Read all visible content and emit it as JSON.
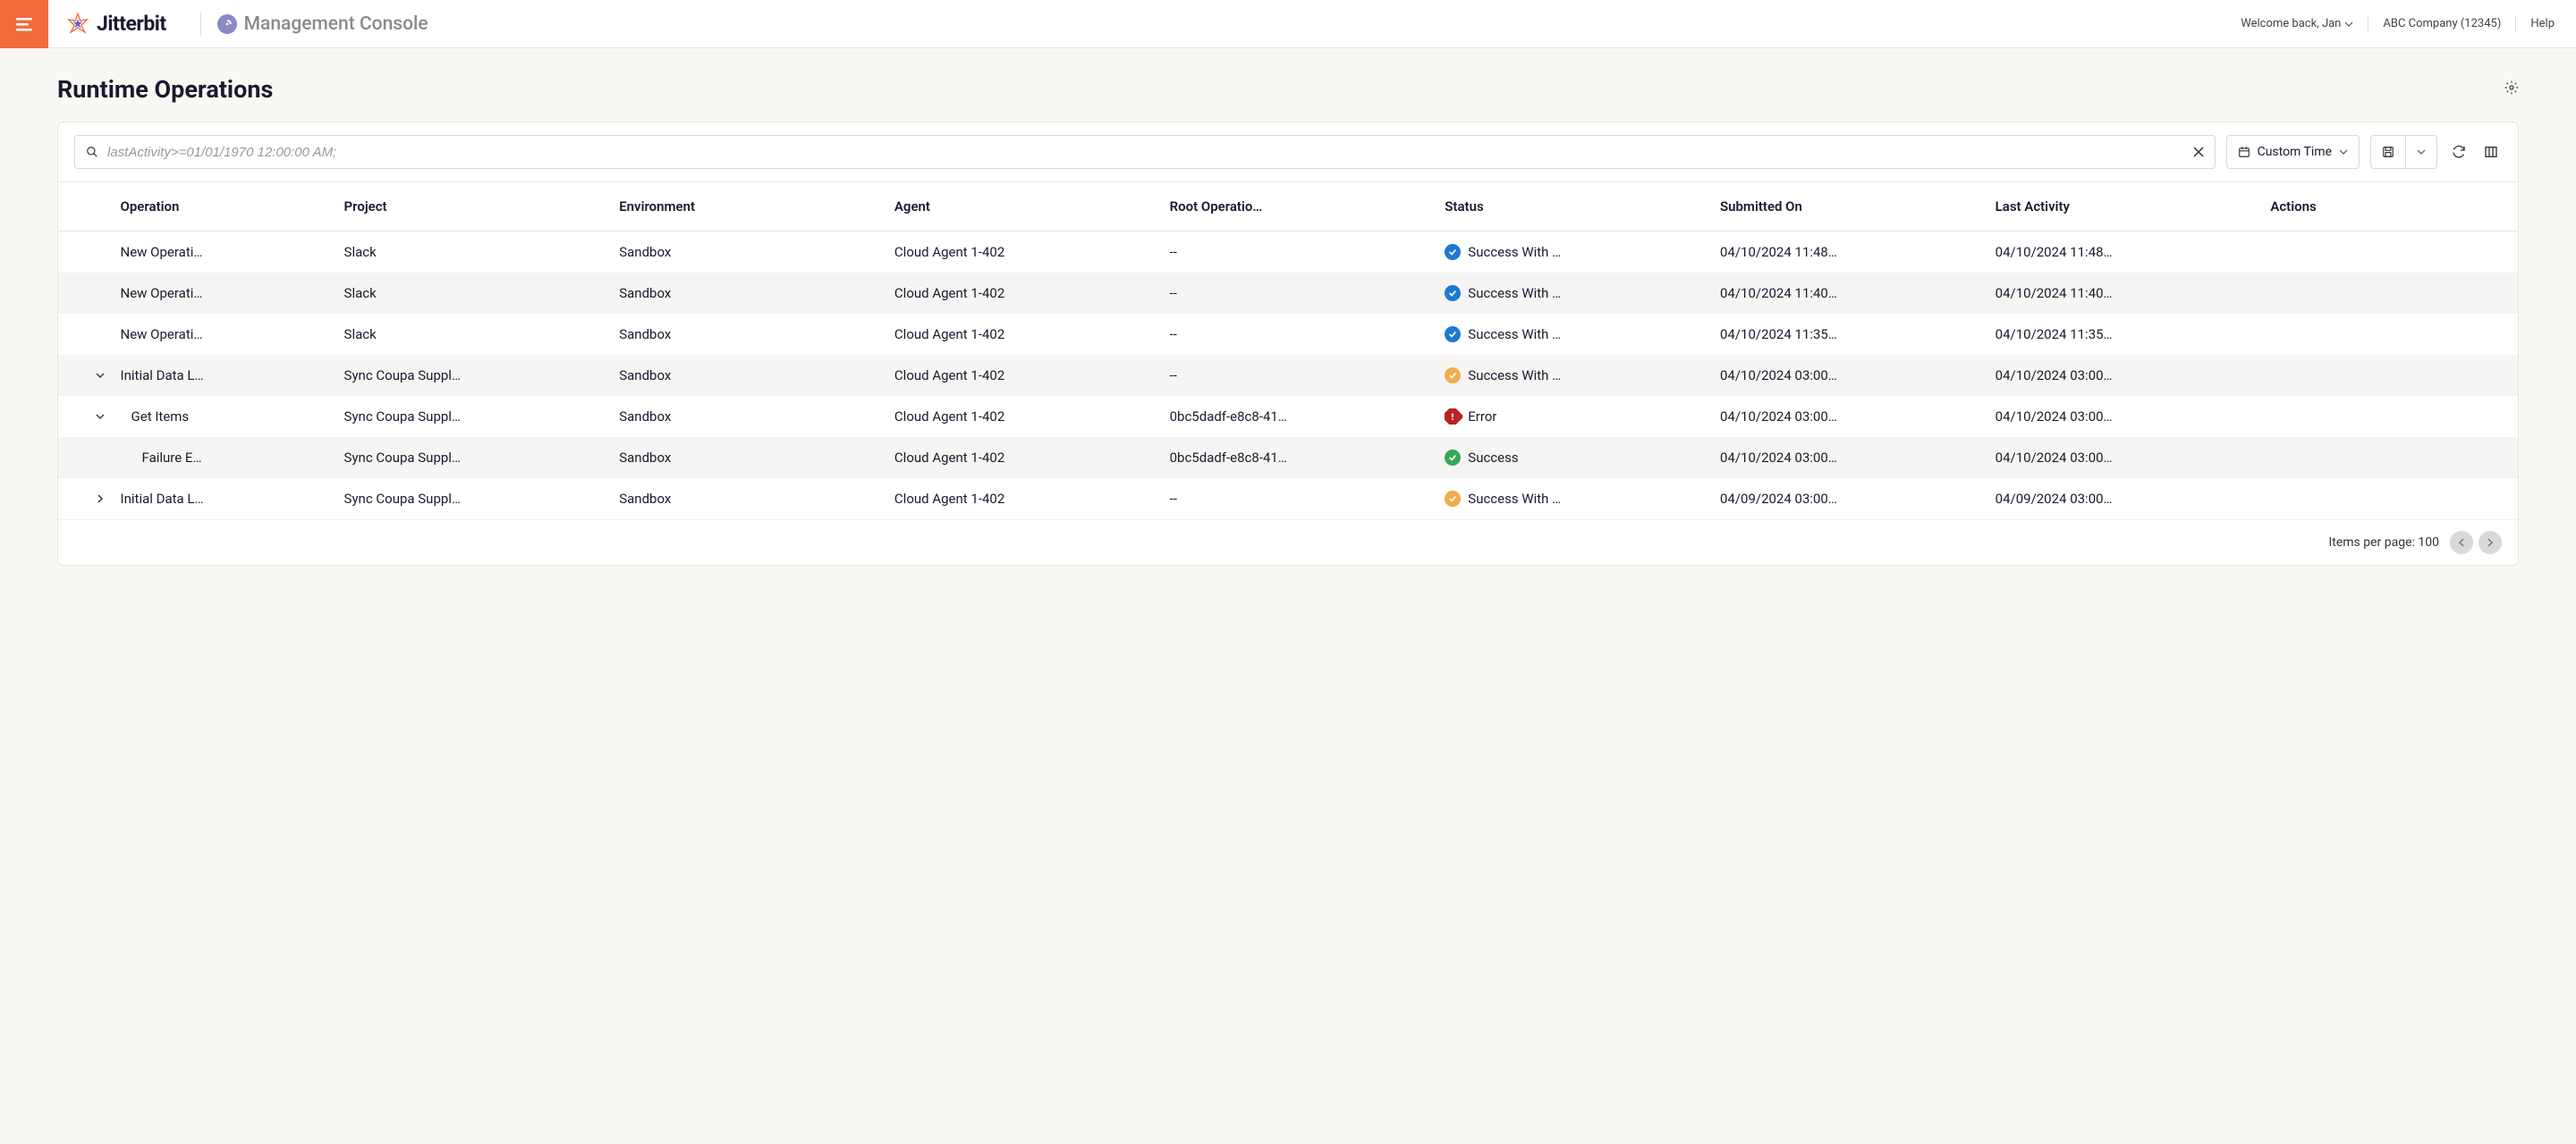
{
  "header": {
    "brand": "Jitterbit",
    "console_title": "Management Console",
    "welcome": "Welcome back, Jan",
    "company": "ABC Company (12345)",
    "help": "Help"
  },
  "page": {
    "title": "Runtime Operations"
  },
  "toolbar": {
    "search_value": "lastActivity>=01/01/1970 12:00:00 AM;",
    "time_label": "Custom Time"
  },
  "columns": {
    "operation": "Operation",
    "project": "Project",
    "environment": "Environment",
    "agent": "Agent",
    "root": "Root Operatio…",
    "status": "Status",
    "submitted": "Submitted On",
    "last": "Last Activity",
    "actions": "Actions"
  },
  "rows": [
    {
      "expand": "none",
      "indent": 0,
      "operation": "New Operati…",
      "project": "Slack",
      "environment": "Sandbox",
      "agent": "Cloud Agent 1-402",
      "root": "--",
      "status_type": "blue",
      "status_text": "Success With …",
      "submitted": "04/10/2024 11:48…",
      "last": "04/10/2024 11:48…"
    },
    {
      "expand": "none",
      "indent": 0,
      "operation": "New Operati…",
      "project": "Slack",
      "environment": "Sandbox",
      "agent": "Cloud Agent 1-402",
      "root": "--",
      "status_type": "blue",
      "status_text": "Success With …",
      "submitted": "04/10/2024 11:40…",
      "last": "04/10/2024 11:40…"
    },
    {
      "expand": "none",
      "indent": 0,
      "operation": "New Operati…",
      "project": "Slack",
      "environment": "Sandbox",
      "agent": "Cloud Agent 1-402",
      "root": "--",
      "status_type": "blue",
      "status_text": "Success With …",
      "submitted": "04/10/2024 11:35…",
      "last": "04/10/2024 11:35…"
    },
    {
      "expand": "open",
      "indent": 0,
      "operation": "Initial Data L…",
      "project": "Sync Coupa Suppl…",
      "environment": "Sandbox",
      "agent": "Cloud Agent 1-402",
      "root": "--",
      "status_type": "yellow",
      "status_text": "Success With …",
      "submitted": "04/10/2024 03:00…",
      "last": "04/10/2024 03:00…"
    },
    {
      "expand": "open",
      "indent": 1,
      "operation": "Get Items",
      "project": "Sync Coupa Suppl…",
      "environment": "Sandbox",
      "agent": "Cloud Agent 1-402",
      "root": "0bc5dadf-e8c8-41…",
      "status_type": "red",
      "status_text": "Error",
      "submitted": "04/10/2024 03:00…",
      "last": "04/10/2024 03:00…"
    },
    {
      "expand": "none",
      "indent": 2,
      "operation": "Failure E…",
      "project": "Sync Coupa Suppl…",
      "environment": "Sandbox",
      "agent": "Cloud Agent 1-402",
      "root": "0bc5dadf-e8c8-41…",
      "status_type": "green",
      "status_text": "Success",
      "submitted": "04/10/2024 03:00…",
      "last": "04/10/2024 03:00…"
    },
    {
      "expand": "closed",
      "indent": 0,
      "operation": "Initial Data L…",
      "project": "Sync Coupa Suppl…",
      "environment": "Sandbox",
      "agent": "Cloud Agent 1-402",
      "root": "--",
      "status_type": "yellow",
      "status_text": "Success With …",
      "submitted": "04/09/2024 03:00…",
      "last": "04/09/2024 03:00…"
    }
  ],
  "footer": {
    "items_label": "Items per page: 100"
  }
}
